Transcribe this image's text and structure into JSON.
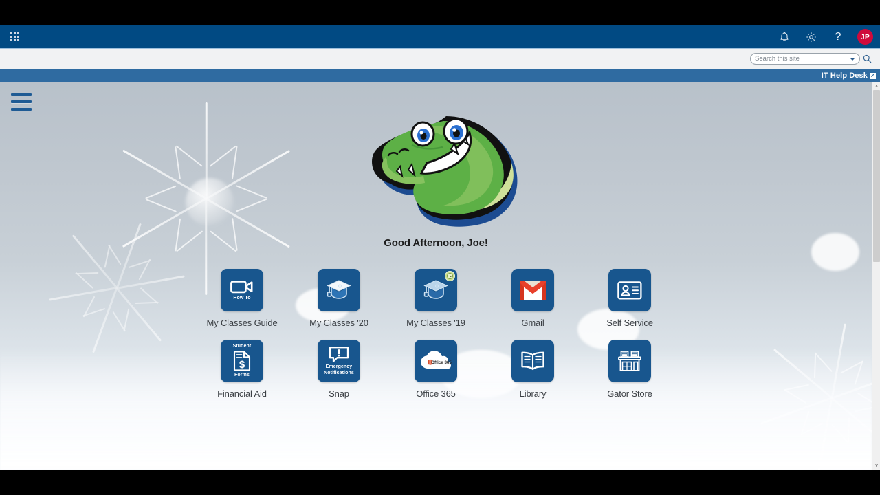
{
  "navbar": {
    "app_launcher_label": "App launcher",
    "notifications_label": "Notifications",
    "settings_label": "Settings",
    "help_label": "?",
    "avatar_initials": "JP",
    "background_color": "#014a83"
  },
  "search": {
    "placeholder": "Search this site",
    "value": "",
    "dropdown_label": "Search scope",
    "button_label": "Search"
  },
  "link_bar": {
    "label": "IT Help Desk",
    "external_icon": "external-link-icon",
    "background_color": "#2f6ba1"
  },
  "menu": {
    "hamburger_label": "Menu"
  },
  "hero": {
    "mascot_alt": "Gator mascot head",
    "greeting": "Good Afternoon, Joe!"
  },
  "tiles": {
    "row1": [
      {
        "label": "My Classes Guide",
        "icon": "video-camera-icon",
        "sub_text": "How To",
        "sub_position": "bottom",
        "badge": null
      },
      {
        "label": "My Classes '20",
        "icon": "graduation-cap-icon",
        "sub_text": "",
        "sub_position": "none",
        "badge": null
      },
      {
        "label": "My Classes '19",
        "icon": "graduation-cap-icon",
        "sub_text": "",
        "sub_position": "none",
        "badge": "clock-badge-icon"
      },
      {
        "label": "Gmail",
        "icon": "gmail-icon",
        "sub_text": "",
        "sub_position": "none",
        "badge": null
      },
      {
        "label": "Self Service",
        "icon": "id-card-icon",
        "sub_text": "",
        "sub_position": "none",
        "badge": null
      }
    ],
    "row2": [
      {
        "label": "Financial Aid",
        "icon": "dollar-document-icon",
        "sub_text": "Student",
        "sub_text2": "Forms",
        "sub_position": "both",
        "badge": null
      },
      {
        "label": "Snap",
        "icon": "alert-speech-bubble-icon",
        "sub_text": "Emergency",
        "sub_text2": "Notifications",
        "sub_position": "bottom2",
        "badge": null
      },
      {
        "label": "Office 365",
        "icon": "office-365-cloud-icon",
        "sub_text": "Office 365",
        "sub_position": "inline",
        "badge": null
      },
      {
        "label": "Library",
        "icon": "open-book-icon",
        "sub_text": "",
        "sub_position": "none",
        "badge": null
      },
      {
        "label": "Gator Store",
        "icon": "store-building-icon",
        "sub_text": "",
        "sub_position": "none",
        "badge": null
      }
    ]
  },
  "scrollbar": {
    "up_arrow": "∧",
    "down_arrow": "∨"
  },
  "theme": {
    "tile_color": "#18568e",
    "avatar_color": "#cf0a3c",
    "accent_blue": "#014a83"
  }
}
